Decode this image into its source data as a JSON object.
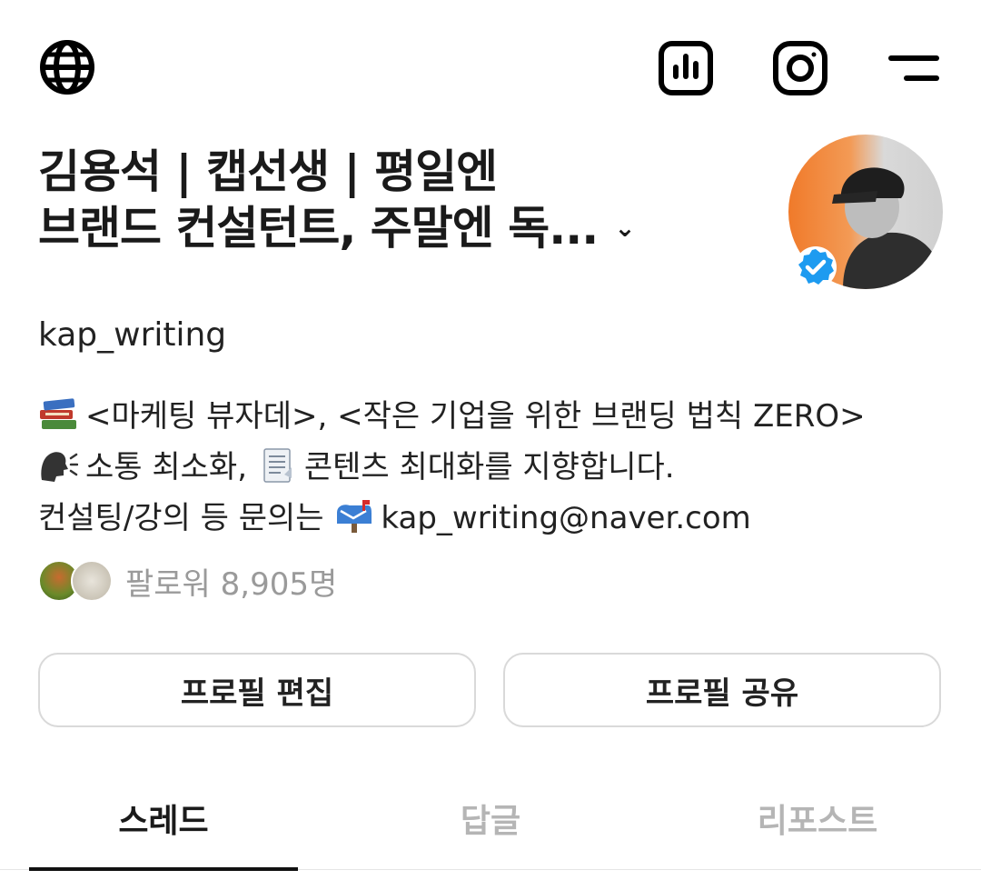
{
  "header": {
    "icons": [
      "globe-icon",
      "insights-icon",
      "instagram-icon",
      "menu-icon"
    ]
  },
  "profile": {
    "name_line1": "김용석 | 캡선생 | 평일엔",
    "name_line2": "브랜드 컨설턴트, 주말엔 독...",
    "expand_icon": "⌄",
    "username": "kap_writing",
    "verified": true,
    "avatar_colors": {
      "left": "#f07a2a",
      "right": "#d9d9d9",
      "badge": "#1d9bf0"
    }
  },
  "bio": {
    "line1_emoji": "books-emoji",
    "line1": "<마케팅 뷰자데>, <작은 기업을 위한 브랜딩 법칙 ZERO>",
    "line2_emoji1": "speaking-head-emoji",
    "line2_part1": "소통 최소화,",
    "line2_emoji2": "page-emoji",
    "line2_part2": "콘텐츠 최대화를 지향합니다.",
    "line3_part1": "컨설팅/강의 등 문의는",
    "line3_emoji": "mailbox-emoji",
    "line3_email": "kap_writing@naver.com"
  },
  "followers": {
    "label": "팔로워 8,905명"
  },
  "actions": {
    "edit_label": "프로필 편집",
    "share_label": "프로필 공유"
  },
  "tabs": [
    {
      "label": "스레드",
      "active": true
    },
    {
      "label": "답글",
      "active": false
    },
    {
      "label": "리포스트",
      "active": false
    }
  ]
}
